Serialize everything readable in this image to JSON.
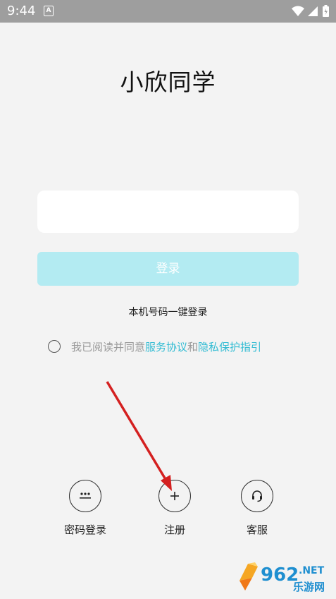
{
  "status_bar": {
    "time": "9:44",
    "notification_icon": "A"
  },
  "app_title": "小欣同学",
  "phone_input": {
    "value": "",
    "placeholder": ""
  },
  "login_button": "登录",
  "one_key_login": "本机号码一键登录",
  "agreement": {
    "prefix": "我已阅读并同意",
    "service_link": "服务协议",
    "connector": "和",
    "privacy_link": "隐私保护指引"
  },
  "bottom_actions": {
    "password_login": "密码登录",
    "register": "注册",
    "customer_service": "客服"
  },
  "watermark": {
    "number": "962",
    "tld": ".NET",
    "name": "乐游网"
  },
  "colors": {
    "accent": "#33bcd3",
    "login_button_disabled": "#b3ebf2",
    "annotation_arrow": "#d42020"
  }
}
